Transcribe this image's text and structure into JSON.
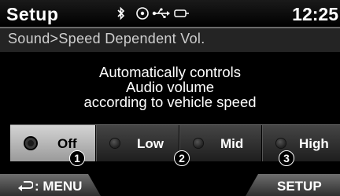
{
  "header": {
    "title": "Setup",
    "clock": "12:25",
    "status_icons": [
      "bluetooth-icon",
      "disc-icon",
      "usb-icon",
      "aux-icon"
    ]
  },
  "breadcrumb": "Sound>Speed Dependent Vol.",
  "description": [
    "Automatically controls",
    "Audio volume",
    "according to vehicle speed"
  ],
  "options": [
    {
      "label": "Off",
      "selected": true
    },
    {
      "label": "Low",
      "selected": false
    },
    {
      "label": "Mid",
      "selected": false
    },
    {
      "label": "High",
      "selected": false
    }
  ],
  "callouts": [
    "1",
    "2",
    "3"
  ],
  "softkeys": {
    "menu": ": MENU",
    "setup": "SETUP"
  }
}
